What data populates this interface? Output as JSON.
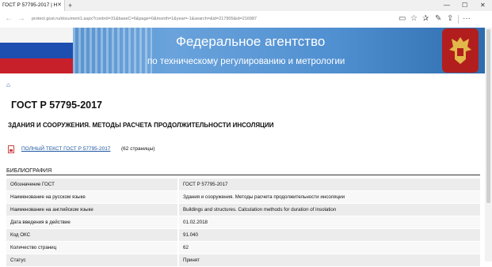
{
  "browser": {
    "tab_title": "ГОСТ Р 57795-2017 | Н",
    "tab_close": "✕",
    "new_tab": "+",
    "url": "protect.gost.ru/document1.aspx?control=31&baseC=6&page=0&month=1&year=-1&search=&id=217905&id=216987",
    "window_minimize": "—",
    "window_maximize": "☐",
    "window_close": "✕"
  },
  "banner": {
    "title": "Федеральное агентство",
    "subtitle": "по техническому регулированию и метрологии"
  },
  "page": {
    "home_icon": "⌂",
    "doc_code": "ГОСТ Р 57795-2017",
    "doc_title": "ЗДАНИЯ И СООРУЖЕНИЯ. МЕТОДЫ РАСЧЕТА ПРОДОЛЖИТЕЛЬНОСТИ ИНСОЛЯЦИИ",
    "fulltext_link": "ПОЛНЫЙ ТЕКСТ ГОСТ Р 57795-2017",
    "fulltext_pages": "(62 страницы)",
    "biblio_heading": "БИБЛИОГРАФИЯ"
  },
  "table": {
    "rows": [
      {
        "label": "Обозначение ГОСТ",
        "value": "ГОСТ Р 57795-2017"
      },
      {
        "label": "Наименование на русском языке",
        "value": "Здания и сооружения. Методы расчета продолжительности инсоляции"
      },
      {
        "label": "Наименование на английском языке",
        "value": "Buildings and structures. Calculation methods for duration of insolation"
      },
      {
        "label": "Дата введения в действие",
        "value": "01.02.2018"
      },
      {
        "label": "Код ОКС",
        "value": "91.040"
      },
      {
        "label": "Количество страниц",
        "value": "62"
      },
      {
        "label": "Статус",
        "value": "Принят"
      }
    ]
  },
  "colors": {
    "banner_blue": "#4f8fd0",
    "link_blue": "#1e56a0",
    "emblem_red": "#b21e1e"
  }
}
